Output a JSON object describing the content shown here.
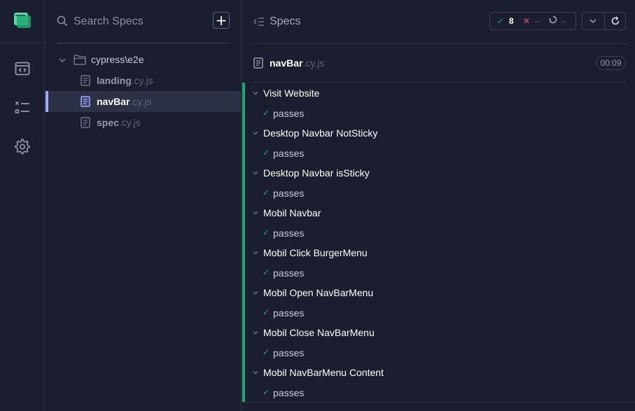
{
  "colors": {
    "background": "#1b1e2e",
    "active_row": "#2d3146",
    "accent": "#a3a9ff",
    "pass": "#1fa971",
    "fail": "#e4577b",
    "logo": "#69d3a7"
  },
  "rail": {
    "logo_icon": "cypress-logo-icon",
    "items": [
      {
        "name": "specs-nav",
        "icon": "browser-code-icon"
      },
      {
        "name": "runs-nav",
        "icon": "test-list-icon"
      },
      {
        "name": "settings-nav",
        "icon": "gear-icon"
      }
    ]
  },
  "sidebar": {
    "search": {
      "placeholder": "Search Specs",
      "value": ""
    },
    "add_label": "+",
    "folder": {
      "label": "cypress\\e2e"
    },
    "files": [
      {
        "name": "landing",
        "ext": ".cy.js",
        "active": false
      },
      {
        "name": "navBar",
        "ext": ".cy.js",
        "active": true
      },
      {
        "name": "spec",
        "ext": ".cy.js",
        "active": false
      }
    ]
  },
  "header": {
    "title": "Specs",
    "stats": {
      "passed_icon": "✓",
      "passed": "8",
      "failed_icon": "✕",
      "failed": "--",
      "pending": "--"
    }
  },
  "spec": {
    "name": "navBar",
    "ext": ".cy.js",
    "duration": "00:09"
  },
  "tests": [
    {
      "suite": "Visit Website",
      "test": "passes",
      "check": "✓"
    },
    {
      "suite": "Desktop Navbar NotSticky",
      "test": "passes",
      "check": "✓"
    },
    {
      "suite": "Desktop Navbar isSticky",
      "test": "passes",
      "check": "✓"
    },
    {
      "suite": "Mobil Navbar",
      "test": "passes",
      "check": "✓"
    },
    {
      "suite": "Mobil Click BurgerMenu",
      "test": "passes",
      "check": "✓"
    },
    {
      "suite": "Mobil Open NavBarMenu",
      "test": "passes",
      "check": "✓"
    },
    {
      "suite": "Mobil Close NavBarMenu",
      "test": "passes",
      "check": "✓"
    },
    {
      "suite": "Mobil NavBarMenu Content",
      "test": "passes",
      "check": "✓"
    }
  ]
}
